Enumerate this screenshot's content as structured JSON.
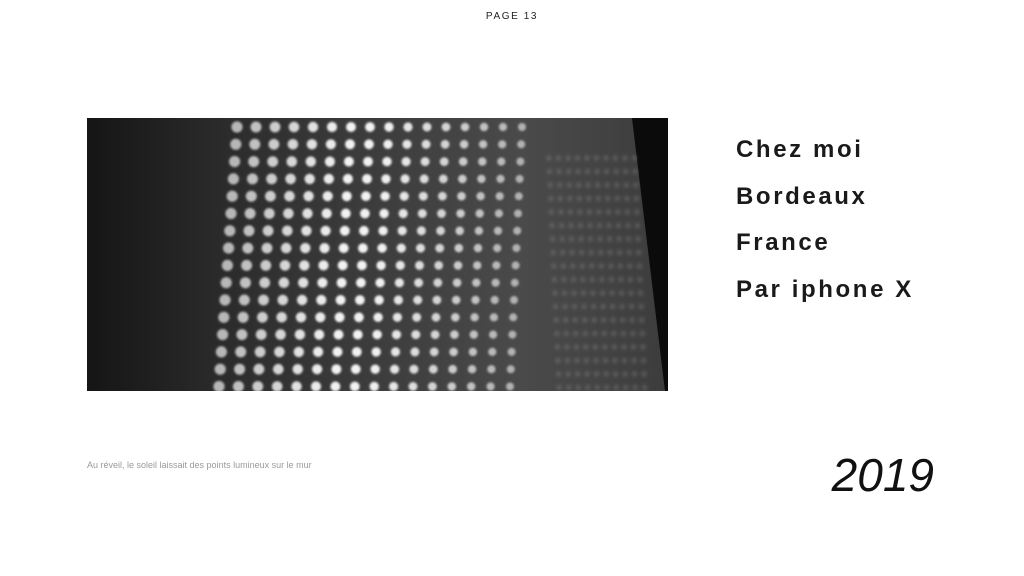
{
  "page": {
    "number_label": "PAGE 13"
  },
  "details": [
    "Chez moi",
    "Bordeaux",
    "France",
    "Par iphone X"
  ],
  "caption": "Au réveil, le soleil laissait des points lumineux sur le mur",
  "year": "2019"
}
